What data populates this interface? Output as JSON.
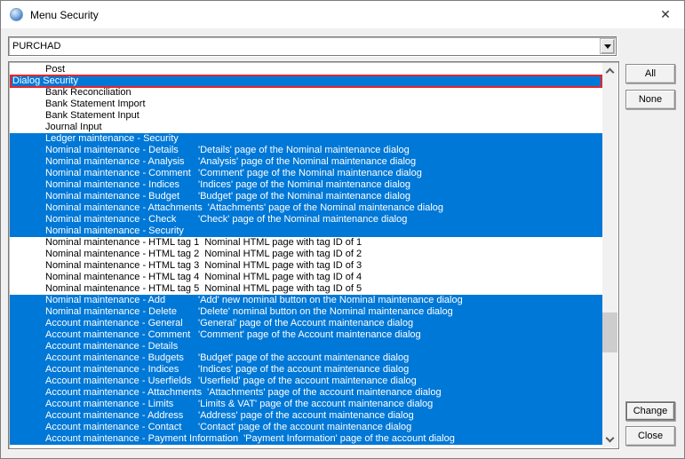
{
  "window": {
    "title": "Menu Security",
    "close_glyph": "✕"
  },
  "combo": {
    "value": "PURCHAD"
  },
  "buttons": {
    "all": "All",
    "none": "None",
    "change": "Change",
    "close": "Close"
  },
  "colors": {
    "selection": "#0078d7",
    "highlight_border": "#e5262b"
  },
  "list": {
    "rows": [
      {
        "label": "Post",
        "desc": "",
        "selected": false,
        "indent": 1,
        "highlight": false
      },
      {
        "label": "Dialog Security",
        "desc": "",
        "selected": true,
        "indent": 0,
        "highlight": true
      },
      {
        "label": "Bank Reconciliation",
        "desc": "",
        "selected": false,
        "indent": 1,
        "highlight": false
      },
      {
        "label": "Bank Statement Import",
        "desc": "",
        "selected": false,
        "indent": 1,
        "highlight": false
      },
      {
        "label": "Bank Statement Input",
        "desc": "",
        "selected": false,
        "indent": 1,
        "highlight": false
      },
      {
        "label": "Journal Input",
        "desc": "",
        "selected": false,
        "indent": 1,
        "highlight": false
      },
      {
        "label": "Ledger maintenance - Security",
        "desc": "",
        "selected": true,
        "indent": 1,
        "highlight": false
      },
      {
        "label": "Nominal maintenance - Details",
        "desc": "'Details' page of the Nominal maintenance dialog",
        "selected": true,
        "indent": 1,
        "highlight": false
      },
      {
        "label": "Nominal maintenance - Analysis",
        "desc": "'Analysis' page of the Nominal maintenance dialog",
        "selected": true,
        "indent": 1,
        "highlight": false
      },
      {
        "label": "Nominal maintenance - Comment",
        "desc": "'Comment' page of the Nominal maintenance dialog",
        "selected": true,
        "indent": 1,
        "highlight": false
      },
      {
        "label": "Nominal maintenance - Indices",
        "desc": "'Indices' page of the Nominal maintenance dialog",
        "selected": true,
        "indent": 1,
        "highlight": false
      },
      {
        "label": "Nominal maintenance - Budget",
        "desc": "'Budget' page of the Nominal maintenance dialog",
        "selected": true,
        "indent": 1,
        "highlight": false
      },
      {
        "label": "Nominal maintenance - Attachments",
        "desc": "'Attachments' page of the Nominal maintenance dialog",
        "selected": true,
        "indent": 1,
        "highlight": false
      },
      {
        "label": "Nominal maintenance - Check",
        "desc": "'Check' page of the Nominal maintenance dialog",
        "selected": true,
        "indent": 1,
        "highlight": false
      },
      {
        "label": "Nominal maintenance - Security",
        "desc": "",
        "selected": true,
        "indent": 1,
        "highlight": false
      },
      {
        "label": "Nominal maintenance - HTML tag 1",
        "desc": "Nominal HTML page with tag ID of 1",
        "selected": false,
        "indent": 1,
        "highlight": false
      },
      {
        "label": "Nominal maintenance - HTML tag 2",
        "desc": "Nominal HTML page with tag ID of 2",
        "selected": false,
        "indent": 1,
        "highlight": false
      },
      {
        "label": "Nominal maintenance - HTML tag 3",
        "desc": "Nominal HTML page with tag ID of 3",
        "selected": false,
        "indent": 1,
        "highlight": false
      },
      {
        "label": "Nominal maintenance - HTML tag 4",
        "desc": "Nominal HTML page with tag ID of 4",
        "selected": false,
        "indent": 1,
        "highlight": false
      },
      {
        "label": "Nominal maintenance - HTML tag 5",
        "desc": "Nominal HTML page with tag ID of 5",
        "selected": false,
        "indent": 1,
        "highlight": false
      },
      {
        "label": "Nominal maintenance - Add",
        "desc": "'Add' new nominal button on the Nominal maintenance dialog",
        "selected": true,
        "indent": 1,
        "highlight": false
      },
      {
        "label": "Nominal maintenance - Delete",
        "desc": "'Delete' nominal button on the Nominal maintenance dialog",
        "selected": true,
        "indent": 1,
        "highlight": false
      },
      {
        "label": "Account maintenance - General",
        "desc": "'General' page of the Account maintenance dialog",
        "selected": true,
        "indent": 1,
        "highlight": false
      },
      {
        "label": "Account maintenance - Comment",
        "desc": "'Comment' page of the Account maintenance dialog",
        "selected": true,
        "indent": 1,
        "highlight": false
      },
      {
        "label": "Account maintenance - Details",
        "desc": "",
        "selected": true,
        "indent": 1,
        "highlight": false
      },
      {
        "label": "Account maintenance - Budgets",
        "desc": "'Budget' page of the account maintenance dialog",
        "selected": true,
        "indent": 1,
        "highlight": false
      },
      {
        "label": "Account maintenance - Indices",
        "desc": "'Indices' page of the account maintenance dialog",
        "selected": true,
        "indent": 1,
        "highlight": false
      },
      {
        "label": "Account maintenance - Userfields",
        "desc": "'Userfield' page of the account maintenance dialog",
        "selected": true,
        "indent": 1,
        "highlight": false
      },
      {
        "label": "Account maintenance - Attachments",
        "desc": "'Attachments' page of the account maintenance dialog",
        "selected": true,
        "indent": 1,
        "highlight": false
      },
      {
        "label": "Account maintenance - Limits",
        "desc": "'Limits & VAT' page of the account maintenance dialog",
        "selected": true,
        "indent": 1,
        "highlight": false
      },
      {
        "label": "Account maintenance - Address",
        "desc": "'Address' page of the account maintenance dialog",
        "selected": true,
        "indent": 1,
        "highlight": false
      },
      {
        "label": "Account maintenance - Contact",
        "desc": "'Contact' page of the account maintenance dialog",
        "selected": true,
        "indent": 1,
        "highlight": false
      },
      {
        "label": "Account maintenance - Payment Information",
        "desc": "'Payment Information' page of the account dialog",
        "selected": true,
        "indent": 1,
        "highlight": false
      }
    ]
  }
}
